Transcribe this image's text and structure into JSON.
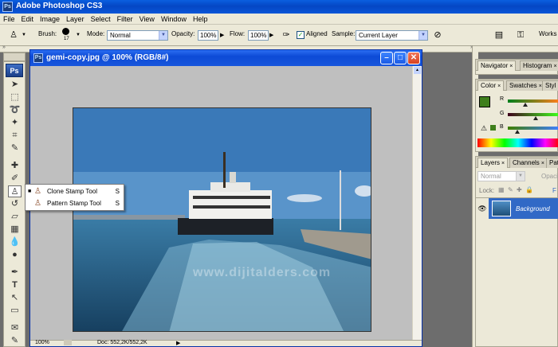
{
  "app": {
    "title": "Adobe Photoshop CS3"
  },
  "menu": [
    "File",
    "Edit",
    "Image",
    "Layer",
    "Select",
    "Filter",
    "View",
    "Window",
    "Help"
  ],
  "options": {
    "brush_label": "Brush:",
    "brush_size": "17",
    "mode_label": "Mode:",
    "mode_value": "Normal",
    "opacity_label": "Opacity:",
    "opacity_value": "100%",
    "flow_label": "Flow:",
    "flow_value": "100%",
    "aligned_label": "Aligned",
    "aligned_checked": true,
    "sample_label": "Sample:",
    "sample_value": "Current Layer",
    "workspace_label": "Works"
  },
  "toolbox": {
    "logo": "Ps",
    "flyout": [
      {
        "label": "Clone Stamp Tool",
        "key": "S",
        "selected": true
      },
      {
        "label": "Pattern Stamp Tool",
        "key": "S",
        "selected": false
      }
    ]
  },
  "document": {
    "title": "gemi-copy.jpg @ 100% (RGB/8#)",
    "zoom": "100%",
    "doc_info": "Doc: 552,2K/552,2K",
    "watermark": "www.dijitalders.com"
  },
  "panels": {
    "nav_tabs": [
      "Navigator",
      "Histogram"
    ],
    "color_tabs": [
      "Color",
      "Swatches",
      "Styl"
    ],
    "color_labels": {
      "r": "R",
      "g": "G",
      "b": "B"
    },
    "layer_tabs": [
      "Layers",
      "Channels",
      "Path"
    ],
    "blend_mode": "Normal",
    "opacity_label": "Opaci",
    "lock_label": "Lock:",
    "fill_label": "F",
    "layer_name": "Background"
  },
  "colors": {
    "foreground": "#3f7f1c",
    "background": "#ffffff",
    "selection": "#3169c6",
    "titlebar": "#0a56d8"
  }
}
